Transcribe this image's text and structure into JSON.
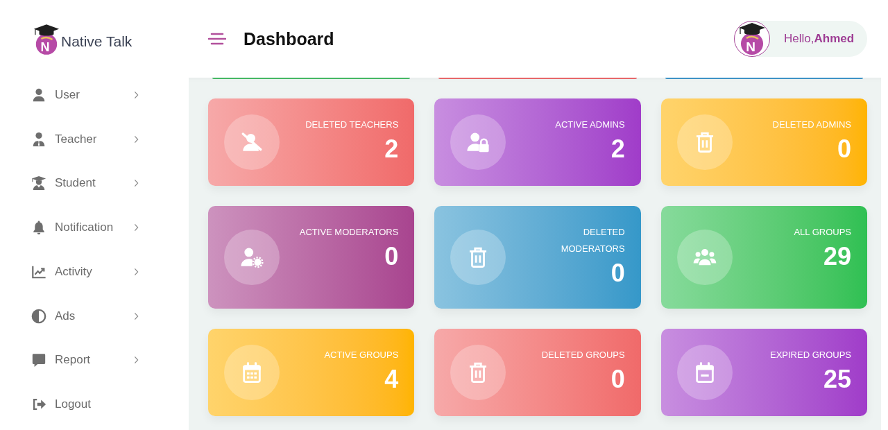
{
  "brand": {
    "mark": "N",
    "name": "Native Talk"
  },
  "sidebar": {
    "items": [
      {
        "label": "User",
        "expandable": true
      },
      {
        "label": "Teacher",
        "expandable": true
      },
      {
        "label": "Student",
        "expandable": true
      },
      {
        "label": "Notification",
        "expandable": true
      },
      {
        "label": "Activity",
        "expandable": true
      },
      {
        "label": "Ads",
        "expandable": true
      },
      {
        "label": "Report",
        "expandable": true
      },
      {
        "label": "Logout",
        "expandable": false
      }
    ]
  },
  "header": {
    "title": "Dashboard",
    "avatar_mark": "N",
    "greeting": "Hello,**Ahmed**"
  },
  "scrolled_cards": [
    {
      "color": "#45b864"
    },
    {
      "color": "#e7676a"
    },
    {
      "color": "#3d93c6"
    }
  ],
  "cards": [
    {
      "label": "DELETED TEACHERS",
      "value": "2",
      "color": "#f06a6a"
    },
    {
      "label": "ACTIVE ADMINS",
      "value": "2",
      "color": "#a03cc9"
    },
    {
      "label": "DELETED ADMINS",
      "value": "0",
      "color": "#ffb400"
    },
    {
      "label": "ACTIVE MODERATORS",
      "value": "0",
      "color": "#a8448f"
    },
    {
      "label": "DELETED MODERATORS",
      "value": "0",
      "color": "#3598c9"
    },
    {
      "label": "ALL GROUPS",
      "value": "29",
      "color": "#2fc053"
    },
    {
      "label": "ACTIVE GROUPS",
      "value": "4",
      "color": "#ffb400"
    },
    {
      "label": "DELETED GROUPS",
      "value": "0",
      "color": "#f06a6a"
    },
    {
      "label": "EXPIRED GROUPS",
      "value": "25",
      "color": "#a03cc9"
    }
  ]
}
